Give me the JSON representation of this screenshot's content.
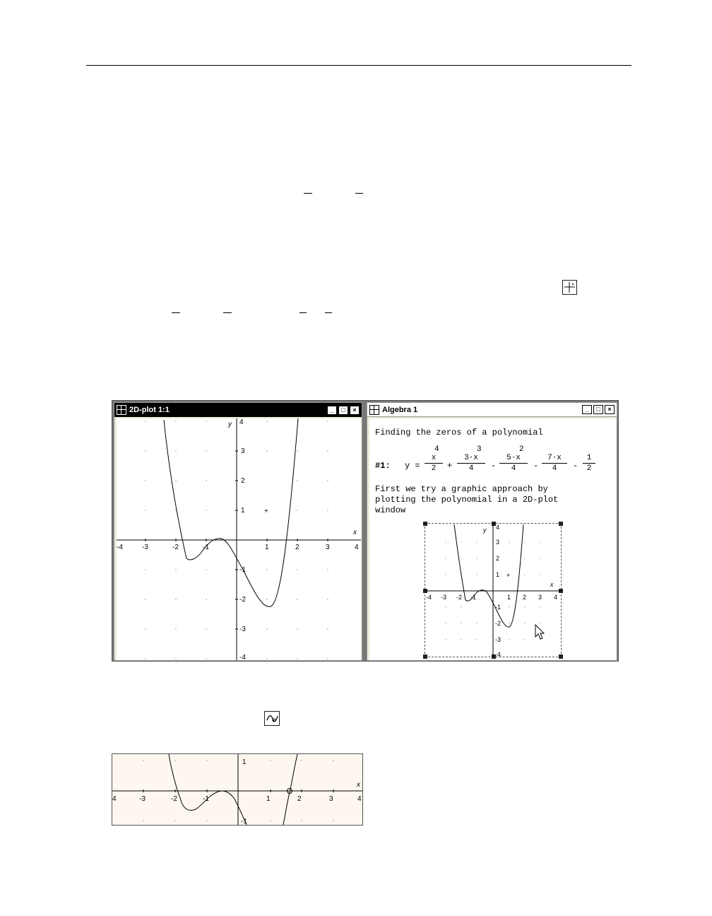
{
  "plot_window": {
    "title": "2D-plot 1:1",
    "controls": {
      "minimize": "_",
      "maximize": "□",
      "close": "×"
    },
    "x_axis_label": "x",
    "y_axis_label": "y",
    "x_ticks": [
      "-4",
      "-3",
      "-2",
      "-1",
      "1",
      "2",
      "3",
      "4"
    ],
    "y_ticks": [
      "4",
      "3",
      "2",
      "1",
      "-1",
      "-2",
      "-3",
      "-4"
    ],
    "cross_marker": "+"
  },
  "algebra_window": {
    "title": "Algebra 1",
    "controls": {
      "minimize": "_",
      "maximize": "□",
      "close": "×"
    },
    "heading_line": "Finding the zeros of a polynomial",
    "expression": {
      "label": "#1:",
      "lhs": "y =",
      "terms": [
        {
          "num": "x",
          "exp": "4",
          "den": "2",
          "op_after": "+"
        },
        {
          "num": "3·x",
          "exp": "3",
          "den": "4",
          "op_after": "-"
        },
        {
          "num": "5·x",
          "exp": "2",
          "den": "4",
          "op_after": "-"
        },
        {
          "num": "7·x",
          "exp": "",
          "den": "4",
          "op_after": "-"
        },
        {
          "num": "1",
          "exp": "",
          "den": "2",
          "op_after": ""
        }
      ]
    },
    "note_lines": [
      "First we try a graphic approach by",
      "plotting the polynomial in a 2D-plot",
      "window"
    ],
    "embedded_plot": {
      "x_ticks": [
        "-4",
        "-3",
        "-2",
        "-1",
        "1",
        "2",
        "3",
        "4"
      ],
      "y_ticks": [
        "4",
        "3",
        "2",
        "1",
        "-1",
        "-2",
        "-3",
        "-4"
      ],
      "x_axis_label": "x",
      "y_axis_label": "y",
      "cross_marker": "+"
    }
  },
  "zoom_plot": {
    "x_ticks": [
      "4",
      "-3",
      "-2",
      "-1",
      "1",
      "2",
      "3",
      "4"
    ],
    "y_ticks": [
      "1",
      "-1"
    ],
    "x_axis_label": "x"
  },
  "icons": {
    "grid_toolbar": "plot-grid-icon",
    "trace_toolbar": "trace-mode-icon"
  }
}
